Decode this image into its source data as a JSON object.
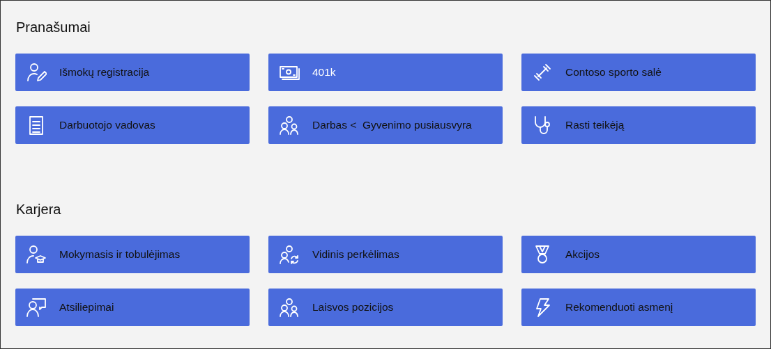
{
  "sections": [
    {
      "title": "Pranašumai",
      "tiles": [
        {
          "label": "Išmokų registracija",
          "light_text": false
        },
        {
          "label": "401k",
          "light_text": true
        },
        {
          "label": "Contoso sporto salė",
          "light_text": false
        },
        {
          "label": "Darbuotojo vadovas",
          "light_text": false
        },
        {
          "label": "Darbas <  Gyvenimo pusiausvyra",
          "light_text": false
        },
        {
          "label": "Rasti teikėją",
          "light_text": false
        }
      ]
    },
    {
      "title": "Karjera",
      "tiles": [
        {
          "label": "Mokymasis ir tobulėjimas",
          "light_text": false
        },
        {
          "label": "Vidinis perkėlimas",
          "light_text": false
        },
        {
          "label": "Akcijos",
          "light_text": false
        },
        {
          "label": "Atsiliepimai",
          "light_text": false
        },
        {
          "label": "Laisvos pozicijos",
          "light_text": false
        },
        {
          "label": "Rekomenduoti asmenį",
          "light_text": false
        }
      ]
    }
  ]
}
